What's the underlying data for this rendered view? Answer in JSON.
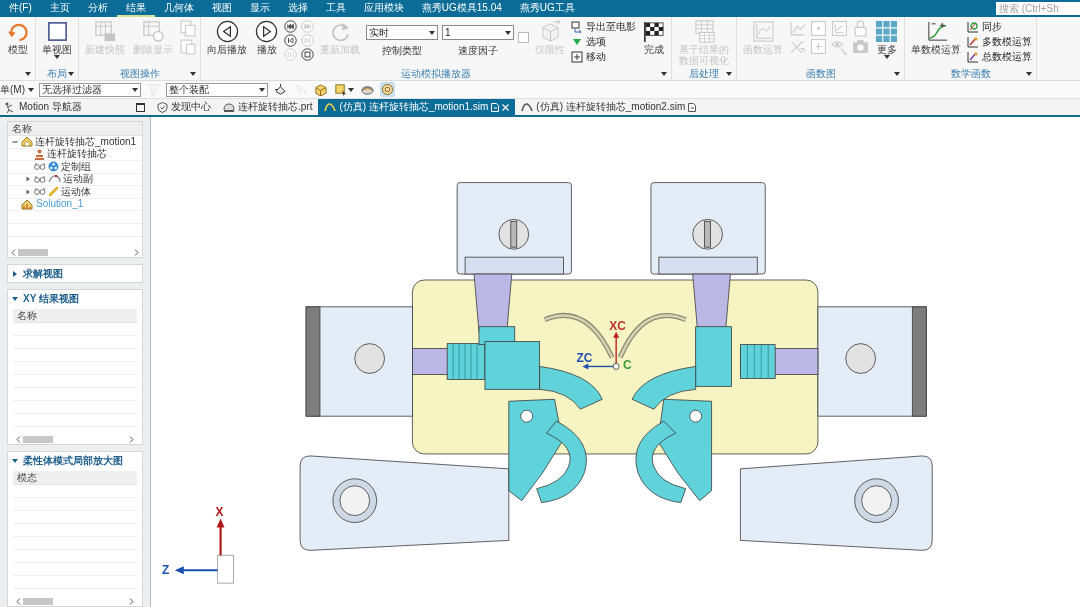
{
  "menu_bar": {
    "tabs": [
      {
        "label": "件(F)",
        "selected": false
      },
      {
        "label": "主页",
        "selected": false
      },
      {
        "label": "分析",
        "selected": false
      },
      {
        "label": "结果",
        "selected": true
      },
      {
        "label": "几何体",
        "selected": false
      },
      {
        "label": "视图",
        "selected": false
      },
      {
        "label": "显示",
        "selected": false
      },
      {
        "label": "选择",
        "selected": false
      },
      {
        "label": "工具",
        "selected": false
      },
      {
        "label": "应用模块",
        "selected": false
      },
      {
        "label": "燕秀UG模具15.04",
        "selected": false
      },
      {
        "label": "燕秀UG工具",
        "selected": false
      }
    ],
    "search": {
      "placeholder": "搜索 (Ctrl+Sh"
    }
  },
  "ribbon": {
    "groups": [
      {
        "columns": [
          {
            "kind": "large",
            "label": "模型",
            "disabled": false
          }
        ]
      },
      {
        "label": "布局",
        "columns": [
          {
            "kind": "large",
            "label": "单视图",
            "disabled": false,
            "dropdown": true
          }
        ]
      },
      {
        "label": "视图操作",
        "columns": [
          {
            "kind": "large",
            "label": "新建快照",
            "disabled": true
          },
          {
            "kind": "large",
            "label": "删除显示",
            "disabled": true
          },
          {
            "kind": "icons",
            "icons": [
              {
                "disabled": true
              },
              {
                "disabled": true
              }
            ]
          }
        ]
      },
      {
        "label": "运动模拟播放器",
        "columns": [
          {
            "kind": "large",
            "label": "向后播放",
            "disabled": false
          },
          {
            "kind": "large",
            "label": "播放",
            "disabled": false
          },
          {
            "kind": "icons",
            "icons": [
              {
                "disabled": false
              },
              {
                "disabled": false
              },
              {
                "disabled": true
              },
              {
                "disabled": true
              },
              {
                "disabled": true
              },
              {
                "disabled": false
              }
            ]
          },
          {
            "kind": "large",
            "label": "重新加载",
            "disabled": true
          },
          {
            "kind": "combo",
            "value": "实时",
            "label": "控制类型"
          },
          {
            "kind": "combo",
            "value": "1",
            "label": "速度因子"
          },
          {
            "kind": "checkbox",
            "checked": false,
            "disabled": true
          },
          {
            "kind": "large",
            "label": "仅限性",
            "disabled": true
          },
          {
            "kind": "list",
            "items": [
              {
                "label": "导出至电影",
                "disabled": false
              },
              {
                "label": "选项",
                "disabled": false
              },
              {
                "label": "移动",
                "disabled": false
              }
            ]
          },
          {
            "kind": "large",
            "label": "完成",
            "disabled": false
          }
        ]
      },
      {
        "label": "后处理",
        "columns": [
          {
            "kind": "large",
            "label": "基于结果的数据可视化",
            "disabled": true
          }
        ]
      },
      {
        "label": "函数图",
        "columns": [
          {
            "kind": "large",
            "label": "函数运算",
            "disabled": true
          },
          {
            "kind": "icons",
            "icons": [
              {
                "disabled": true
              },
              {
                "disabled": true
              },
              {
                "disabled": true
              },
              {
                "disabled": true
              },
              {
                "disabled": true
              },
              {
                "disabled": true
              },
              {
                "disabled": true
              },
              {
                "disabled": true
              }
            ]
          },
          {
            "kind": "large",
            "label": "更多",
            "disabled": false,
            "dropdown": true
          }
        ]
      },
      {
        "label": "数学函数",
        "columns": [
          {
            "kind": "large",
            "label": "单数模运算",
            "disabled": false
          },
          {
            "kind": "list",
            "items": [
              {
                "label": "同步",
                "disabled": false
              },
              {
                "label": "多数模运算",
                "disabled": false
              },
              {
                "label": "总数模运算",
                "disabled": false
              }
            ]
          }
        ]
      }
    ]
  },
  "selection_bar": {
    "items": [
      {
        "kind": "menu",
        "label": "单(M)"
      },
      {
        "kind": "combo",
        "value": "无选择过滤器"
      },
      {
        "kind": "tool",
        "disabled": true,
        "selected": false,
        "dropdown": false
      },
      {
        "kind": "combo",
        "value": "整个装配"
      },
      {
        "kind": "tool",
        "disabled": false,
        "selected": false,
        "dropdown": false
      },
      {
        "kind": "tool",
        "disabled": true,
        "selected": false,
        "dropdown": false
      },
      {
        "kind": "tool",
        "disabled": false,
        "selected": false,
        "dropdown": false
      },
      {
        "kind": "tool",
        "disabled": false,
        "selected": false,
        "dropdown": true
      },
      {
        "kind": "tool",
        "disabled": false,
        "selected": false,
        "dropdown": false
      },
      {
        "kind": "tool",
        "disabled": false,
        "selected": true,
        "dropdown": false
      }
    ]
  },
  "navigator": {
    "title": "Motion 导航器",
    "column": "名称",
    "tree": [
      {
        "label": "连杆旋转抽芯_motion1",
        "kind": "simulation",
        "expanded": true,
        "active": false,
        "children": [
          {
            "label": "连杆旋转抽芯",
            "kind": "part",
            "active": false
          },
          {
            "label": "定制组",
            "kind": "group",
            "active": false
          },
          {
            "label": "运动副",
            "kind": "joints",
            "expanded": false,
            "active": false
          },
          {
            "label": "运动体",
            "kind": "links",
            "expanded": false,
            "active": false
          }
        ]
      },
      {
        "label": "Solution_1",
        "kind": "solution",
        "active": true
      }
    ]
  },
  "sections": [
    {
      "title": "求解视图",
      "expanded": false
    },
    {
      "title": "XY 结果视图",
      "expanded": true,
      "column": "名称"
    },
    {
      "title": "柔性体模式局部放大图",
      "expanded": true,
      "column": "模态"
    }
  ],
  "documents": [
    {
      "label": "发现中心",
      "kind": "home",
      "selected": false
    },
    {
      "label": "连杆旋转抽芯.prt",
      "kind": "part",
      "selected": false
    },
    {
      "label": "(仿真) 连杆旋转抽芯_motion1.sim",
      "kind": "sim",
      "selected": true
    },
    {
      "label": "(仿真) 连杆旋转抽芯_motion2.sim",
      "kind": "sim",
      "selected": false
    }
  ],
  "viewport": {
    "csys_labels": [
      {
        "text": "XC",
        "color": "#c03030"
      },
      {
        "text": "ZC",
        "color": "#1f4fb0"
      },
      {
        "text": "C",
        "color": "#3a9a3a"
      }
    ],
    "triad_labels": [
      {
        "text": "X",
        "color": "#b01818"
      },
      {
        "text": "Z",
        "color": "#1a4fb0"
      }
    ]
  }
}
